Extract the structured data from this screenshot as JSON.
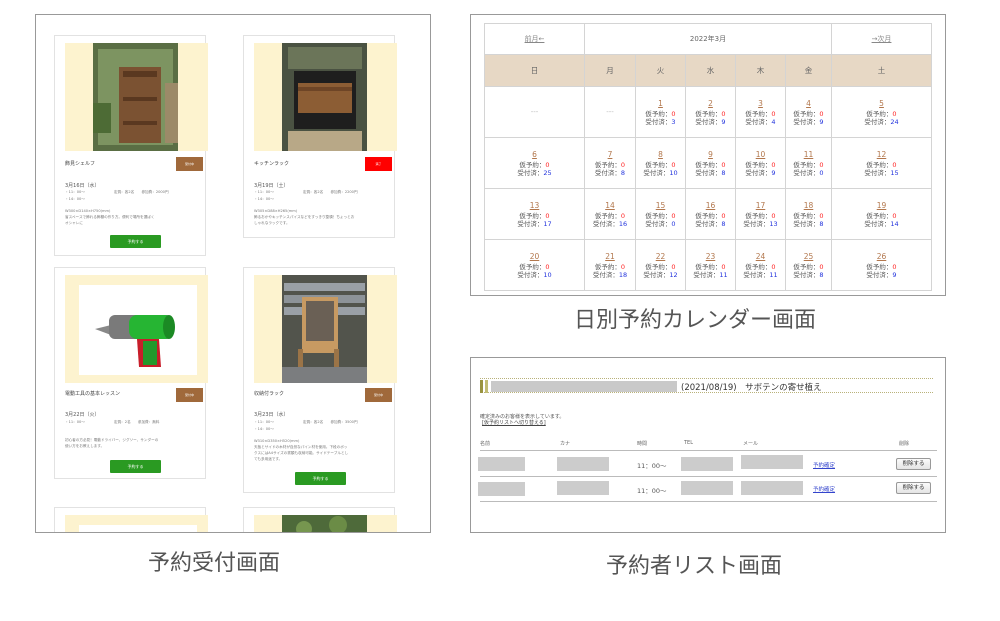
{
  "reception": {
    "cards": [
      {
        "title": "飾見シェルフ",
        "badge": "受付中",
        "date": "3月16日（水）",
        "time1": "・11：00〜",
        "time2": "・14：00〜",
        "info": "定員：各2名　　参加費：2000円",
        "size": "W300×D140×H750(mm)",
        "desc1": "省スペースで飾れる飾棚の作り方。便利で場所を選ばく",
        "desc2": "オシャレに",
        "button": "予約する"
      },
      {
        "title": "キッチンラック",
        "badge": "満了",
        "date": "3月19日（土）",
        "time1": "・11：00〜",
        "time2": "・14：00〜",
        "info": "定員：各2名　　参加費：2200円",
        "size": "W305×D88×H265(mm)",
        "desc1": "飾るおかやキッチンスパイスなどをすっきり整頓！ちょっとお",
        "desc2": "しゃれなラックです。",
        "button": ""
      },
      {
        "title": "電動工具の基本レッスン",
        "badge": "受付中",
        "date": "3月22日（火）",
        "time1": "・11：00〜",
        "time2": "",
        "info": "定員：2名　　参加費：無料",
        "size": "",
        "desc1": "初心者の方必見！電動ドライバー、ジグソー、サンダーの",
        "desc2": "使い方をお教えします。",
        "button": "予約する"
      },
      {
        "title": "収納付ラック",
        "badge": "受付中",
        "date": "3月23日（水）",
        "time1": "・11：00〜",
        "time2": "・14：00〜",
        "info": "定員：各2名　　参加費：3500円",
        "size": "W310×D350×H520(mm)",
        "desc1": "天板とサイドの木材が自然なパイン材を使用。下段のボッ",
        "desc2": "クスにはA4サイズの書類も収納可能。サイドテーブルとし",
        "desc3": "ても多用途です。",
        "button": "予約する"
      }
    ]
  },
  "calendar": {
    "prev": "前月←",
    "month": "2022年3月",
    "next": "→次月",
    "headers": [
      "日",
      "月",
      "火",
      "水",
      "木",
      "金",
      "土"
    ],
    "empty": "---",
    "prov_label": "仮予約：",
    "acc_label": "受付済：",
    "weeks": [
      [
        {
          "d": ""
        },
        {
          "d": ""
        },
        {
          "d": "1",
          "p": "0",
          "a": "3"
        },
        {
          "d": "2",
          "p": "0",
          "a": "9"
        },
        {
          "d": "3",
          "p": "0",
          "a": "4"
        },
        {
          "d": "4",
          "p": "0",
          "a": "9"
        },
        {
          "d": "5",
          "p": "0",
          "a": "24"
        }
      ],
      [
        {
          "d": "6",
          "p": "0",
          "a": "25"
        },
        {
          "d": "7",
          "p": "0",
          "a": "8"
        },
        {
          "d": "8",
          "p": "0",
          "a": "10"
        },
        {
          "d": "9",
          "p": "0",
          "a": "8"
        },
        {
          "d": "10",
          "p": "0",
          "a": "9"
        },
        {
          "d": "11",
          "p": "0",
          "a": "0"
        },
        {
          "d": "12",
          "p": "0",
          "a": "15"
        }
      ],
      [
        {
          "d": "13",
          "p": "0",
          "a": "17"
        },
        {
          "d": "14",
          "p": "0",
          "a": "16"
        },
        {
          "d": "15",
          "p": "0",
          "a": "0"
        },
        {
          "d": "16",
          "p": "0",
          "a": "8"
        },
        {
          "d": "17",
          "p": "0",
          "a": "13"
        },
        {
          "d": "18",
          "p": "0",
          "a": "8"
        },
        {
          "d": "19",
          "p": "0",
          "a": "14"
        }
      ],
      [
        {
          "d": "20",
          "p": "0",
          "a": "10"
        },
        {
          "d": "21",
          "p": "0",
          "a": "18"
        },
        {
          "d": "22",
          "p": "0",
          "a": "12"
        },
        {
          "d": "23",
          "p": "0",
          "a": "11"
        },
        {
          "d": "24",
          "p": "0",
          "a": "11"
        },
        {
          "d": "25",
          "p": "0",
          "a": "8"
        },
        {
          "d": "26",
          "p": "0",
          "a": "9"
        }
      ]
    ]
  },
  "reslist": {
    "event": "(2021/08/19)　サボテンの寄せ植え",
    "note": "確定済みのお客様を表示しています。",
    "link": "[仮予約リストへ切り替える]",
    "headers": {
      "name": "名前",
      "kana": "カナ",
      "time": "時間",
      "tel": "TEL",
      "mail": "メール",
      "del": "削除"
    },
    "rows": [
      {
        "time": "11：00〜",
        "confirm": "予約確定",
        "delete": "削除する"
      },
      {
        "time": "11：00〜",
        "confirm": "予約確定",
        "delete": "削除する"
      }
    ]
  },
  "captions": {
    "calendar": "日別予約カレンダー画面",
    "reception": "予約受付画面",
    "list": "予約者リスト画面"
  },
  "colors": {
    "badge_brown": "#a0693b",
    "badge_red": "#ff0000",
    "reserve_green": "#2a9a22",
    "cal_header": "#e7d8c5",
    "count_red": "#ff2222",
    "count_blue": "#2233dd"
  }
}
